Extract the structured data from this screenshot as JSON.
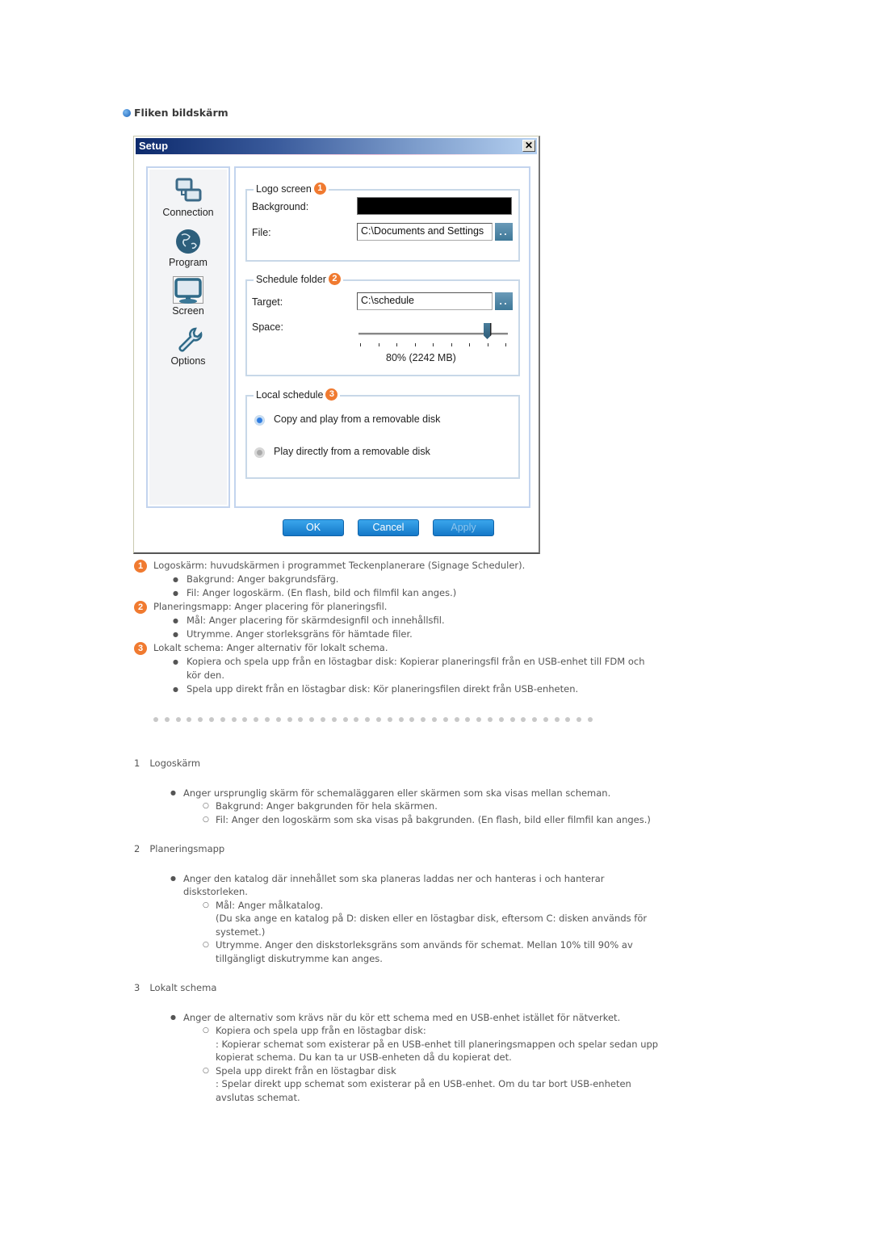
{
  "section_heading": "Fliken bildskärm",
  "window": {
    "title": "Setup",
    "close_label": "x",
    "sidebar": [
      {
        "label": "Connection",
        "icon": "connection-icon"
      },
      {
        "label": "Program",
        "icon": "globe-icon"
      },
      {
        "label": "Screen",
        "icon": "monitor-icon",
        "selected": true
      },
      {
        "label": "Options",
        "icon": "wrench-icon"
      }
    ],
    "logo_screen": {
      "legend": "Logo screen",
      "badge": "1",
      "background_label": "Background:",
      "background_color": "#000000",
      "file_label": "File:",
      "file_value": "C:\\Documents and Settings",
      "browse_label": ".."
    },
    "schedule_folder": {
      "legend": "Schedule folder",
      "badge": "2",
      "target_label": "Target:",
      "target_value": "C:\\schedule",
      "browse_label": "..",
      "space_label": "Space:",
      "space_percent": 80,
      "space_min": 10,
      "space_max": 90,
      "space_readout": "80% (2242 MB)"
    },
    "local_schedule": {
      "legend": "Local schedule",
      "badge": "3",
      "options": [
        {
          "label": "Copy and play from a removable disk",
          "selected": true
        },
        {
          "label": "Play directly from a removable disk",
          "selected": false
        }
      ]
    },
    "buttons": {
      "ok": "OK",
      "cancel": "Cancel",
      "apply": "Apply"
    }
  },
  "notes": [
    {
      "badge": "1",
      "text": "Logoskärm: huvudskärmen i programmet Teckenplanerare (Signage Scheduler).",
      "items": [
        "Bakgrund: Anger bakgrundsfärg.",
        "Fil: Anger logoskärm. (En flash, bild och filmfil kan anges.)"
      ]
    },
    {
      "badge": "2",
      "text": "Planeringsmapp: Anger placering för planeringsfil.",
      "items": [
        "Mål: Anger placering för skärmdesignfil och innehållsfil.",
        "Utrymme. Anger storleksgräns för hämtade filer."
      ]
    },
    {
      "badge": "3",
      "text": "Lokalt schema: Anger alternativ för lokalt schema.",
      "items": [
        "Kopiera och spela upp från en löstagbar disk: Kopierar planeringsfil från en USB-enhet till FDM och kör den.",
        "Spela upp direkt från en löstagbar disk: Kör planeringsfilen direkt från USB-enheten."
      ]
    }
  ],
  "sections": [
    {
      "num": "1",
      "title": "Logoskärm",
      "bullet": "Anger ursprunglig skärm för schemaläggaren eller skärmen som ska visas mellan scheman.",
      "subs": [
        {
          "text": "Bakgrund: Anger bakgrunden för hela skärmen.",
          "cont": ""
        },
        {
          "text": "Fil: Anger den logoskärm som ska visas på bakgrunden. (En flash, bild eller filmfil kan anges.)",
          "cont": ""
        }
      ]
    },
    {
      "num": "2",
      "title": "Planeringsmapp",
      "bullet": "Anger den katalog där innehållet som ska planeras laddas ner och hanteras i och hanterar diskstorleken.",
      "subs": [
        {
          "text": "Mål: Anger målkatalog.",
          "cont": "(Du ska ange en katalog på D: disken eller en löstagbar disk, eftersom C: disken används för systemet.)"
        },
        {
          "text": "Utrymme. Anger den diskstorleksgräns som används för schemat. Mellan 10% till 90% av tillgängligt diskutrymme kan anges.",
          "cont": ""
        }
      ]
    },
    {
      "num": "3",
      "title": "Lokalt schema",
      "bullet": "Anger de alternativ som krävs när du kör ett schema med en USB-enhet istället för nätverket.",
      "subs": [
        {
          "text": "Kopiera och spela upp från en löstagbar disk:",
          "cont": ": Kopierar schemat som existerar på en USB-enhet till planeringsmappen och spelar sedan upp kopierat schema. Du kan ta ur USB-enheten då du kopierat det."
        },
        {
          "text": "Spela upp direkt från en löstagbar disk",
          "cont": ": Spelar direkt upp schemat som existerar på en USB-enhet. Om du tar bort USB-enheten avslutas schemat."
        }
      ]
    }
  ]
}
